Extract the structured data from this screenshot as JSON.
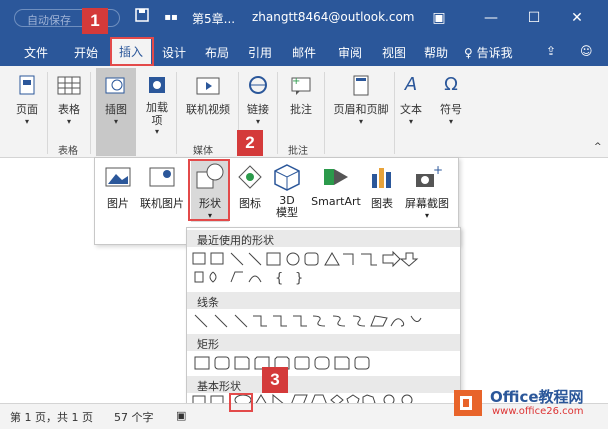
{
  "titlebar": {
    "autosave_label": "自动保存",
    "save_icon": "save-icon",
    "filename": "第5章...",
    "account": "zhangtt8464@outlook.com"
  },
  "tabs": [
    "文件",
    "开始",
    "插入",
    "设计",
    "布局",
    "引用",
    "邮件",
    "审阅",
    "视图",
    "帮助"
  ],
  "tell_me": "告诉我",
  "ribbon": {
    "page": "页面",
    "table": "表格",
    "table_group": "表格",
    "illustrations": "插图",
    "addins": "加载\n项",
    "online_video": "联机视频",
    "media_group": "媒体",
    "links": "链接",
    "comment": "批注",
    "comment_group": "批注",
    "header_footer": "页眉和页脚",
    "text": "文本",
    "symbol": "符号"
  },
  "illustrations_panel": {
    "picture": "图片",
    "online_picture": "联机图片",
    "shapes": "形状",
    "icons": "图标",
    "model3d_line1": "3D",
    "model3d_line2": "模型",
    "smartart": "SmartArt",
    "chart": "图表",
    "screenshot": "屏幕截图"
  },
  "shapes_gallery": {
    "recent": "最近使用的形状",
    "lines": "线条",
    "rectangles": "矩形",
    "basic": "基本形状"
  },
  "status": {
    "page": "第 1 页，共 1 页",
    "words": "57 个字"
  },
  "badges": [
    "1",
    "2",
    "3"
  ],
  "watermark": {
    "brand": "Office教程网",
    "url": "www.office26.com"
  },
  "colors": {
    "accent": "#2b579a",
    "highlight": "#e34a4a",
    "badge": "#d43a3a"
  }
}
